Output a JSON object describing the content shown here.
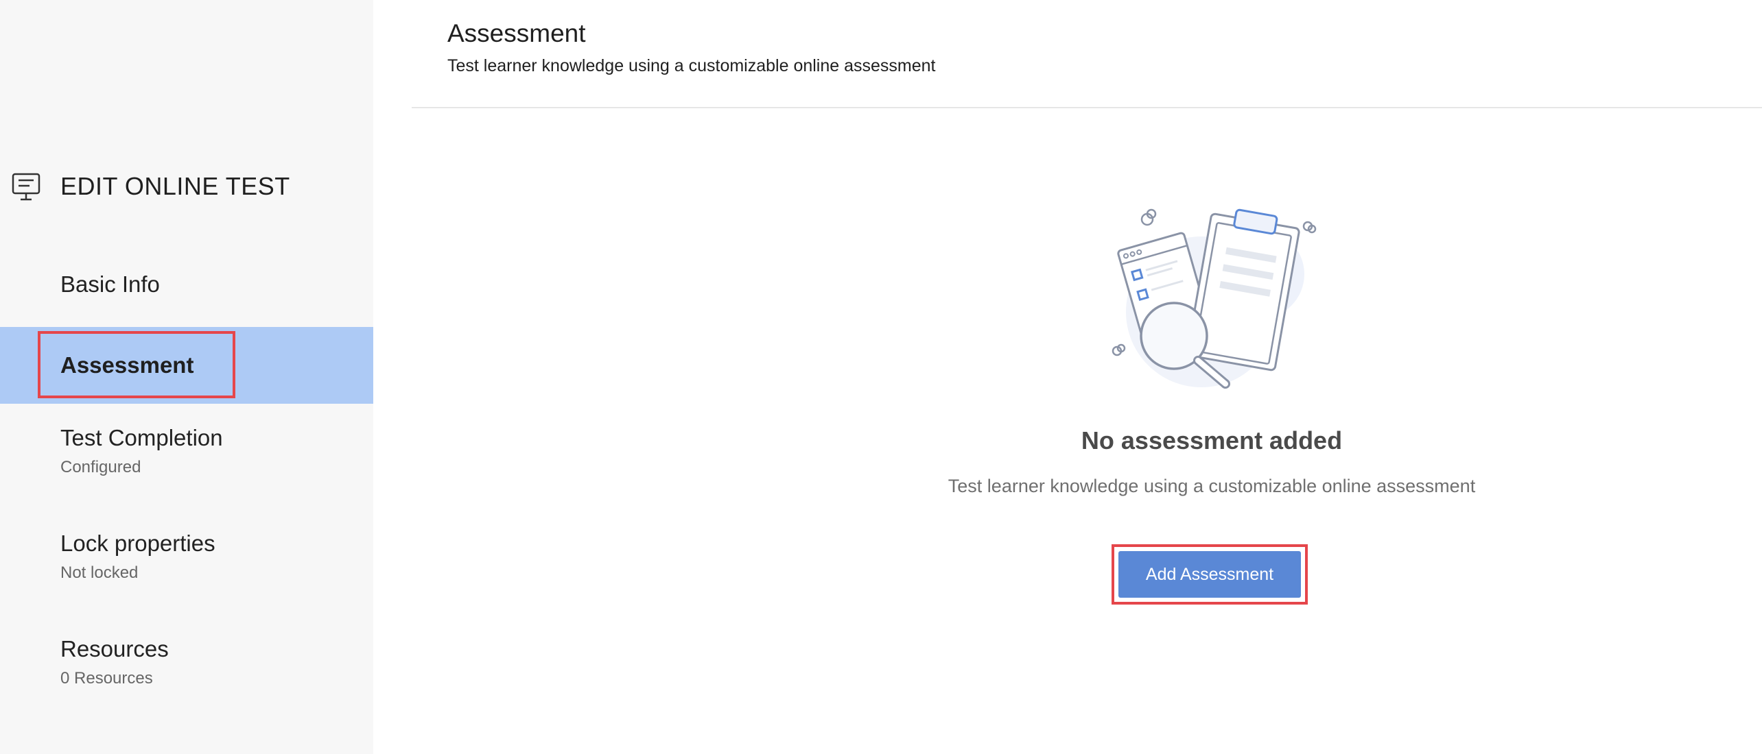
{
  "sidebar": {
    "title": "EDIT ONLINE TEST",
    "items": [
      {
        "label": "Basic Info",
        "sub": ""
      },
      {
        "label": "Assessment",
        "sub": ""
      },
      {
        "label": "Test Completion",
        "sub": "Configured"
      },
      {
        "label": "Lock properties",
        "sub": "Not locked"
      },
      {
        "label": "Resources",
        "sub": "0 Resources"
      }
    ],
    "active_item": "Assessment"
  },
  "header": {
    "title": "Assessment",
    "subtitle": "Test learner knowledge using a customizable online assessment"
  },
  "empty_state": {
    "title": "No assessment added",
    "description": "Test learner knowledge using a customizable online assessment",
    "button_label": "Add Assessment"
  },
  "colors": {
    "active_nav_bg": "#adcaf5",
    "button_bg": "#5a88d6",
    "highlight_border": "#e5464b"
  }
}
